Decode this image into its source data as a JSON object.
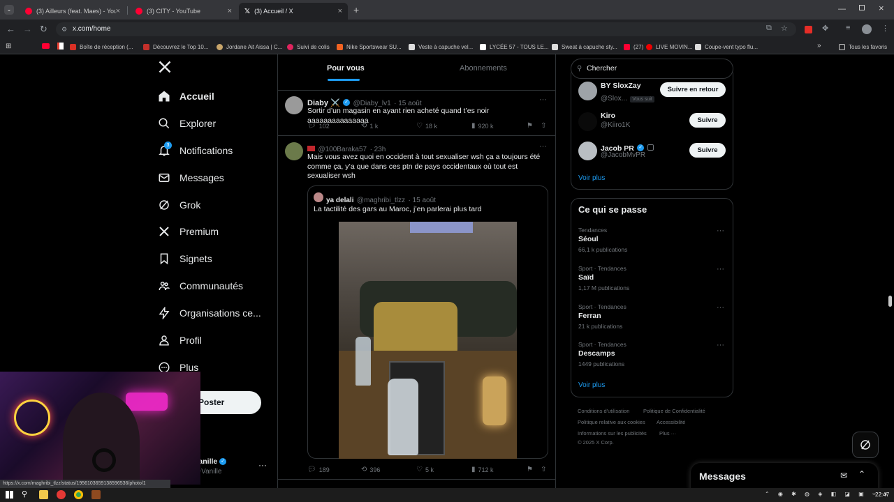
{
  "browser": {
    "tabs": [
      {
        "title": "(3) Ailleurs (feat. Maes) - YouTube",
        "favicon": "youtube-icon"
      },
      {
        "title": "(3) CITY - YouTube",
        "favicon": "youtube-icon"
      },
      {
        "title": "(3) Accueil / X",
        "favicon": "x-icon",
        "active": true
      }
    ],
    "url": "x.com/home",
    "bookmarks": [
      "Boîte de réception (...",
      "Découvrez le Top 10...",
      "Jordane Ait Aissa | C...",
      "Suivi de colis",
      "Nike Sportswear SU...",
      "Veste à capuche vel...",
      "LYCÉE 57 - TOUS LE...",
      "Sweat à capuche sty...",
      "(27)",
      "LIVE MOVIN...",
      "Coupe-vent typo flu..."
    ],
    "all_bookmarks": "Tous les favoris",
    "status_url": "https://x.com/maghribi_tlzz/status/1956103659138596536/photo/1"
  },
  "nav": {
    "items": [
      {
        "label": "Accueil",
        "icon": "home-icon"
      },
      {
        "label": "Explorer",
        "icon": "search-icon"
      },
      {
        "label": "Notifications",
        "icon": "bell-icon",
        "badge": "3"
      },
      {
        "label": "Messages",
        "icon": "envelope-icon"
      },
      {
        "label": "Grok",
        "icon": "grok-icon"
      },
      {
        "label": "Premium",
        "icon": "x-icon"
      },
      {
        "label": "Signets",
        "icon": "bookmark-icon"
      },
      {
        "label": "Communautés",
        "icon": "people-icon"
      },
      {
        "label": "Organisations ce...",
        "icon": "lightning-icon"
      },
      {
        "label": "Profil",
        "icon": "person-icon"
      },
      {
        "label": "Plus",
        "icon": "more-icon"
      }
    ],
    "post_label": "Poster",
    "account_name": "Vanille",
    "account_handle": "@Vanille"
  },
  "feed": {
    "tabs": [
      "Pour vous",
      "Abonnements"
    ],
    "tweet1": {
      "name": "Diaby ⚔️",
      "handle": "@Diaby_lv1",
      "time": "· 15 août",
      "text": "Sortir d’un magasin en ayant rien acheté quand t’es noir aaaaaaaaaaaaaaa",
      "replies": "102",
      "retweets": "1 k",
      "likes": "18 k",
      "views": "920 k"
    },
    "tweet2": {
      "handle": "@100Baraka57",
      "time": "· 23h",
      "text": "Mais vous avez quoi en occident à tout sexualiser wsh ça a toujours été comme ça, y’a que dans ces ptn de pays occidentaux où tout est sexualiser wsh",
      "quote_name": "ya delali",
      "quote_handle": "@maghribi_tlzz",
      "quote_time": "· 15 août",
      "quote_text": "La tactilité des gars au Maroc, j’en parlerai plus tard",
      "replies": "189",
      "retweets": "396",
      "likes": "5 k",
      "views": "712 k"
    }
  },
  "sidebar": {
    "search_placeholder": "Chercher",
    "follows": [
      {
        "name": "BY SloxZay",
        "handle": "@Slox...",
        "badge": "Vous suit",
        "button": "Suivre en retour"
      },
      {
        "name": "Kiro",
        "handle": "@Kiiro1K",
        "button": "Suivre"
      },
      {
        "name": "Jacob PR",
        "handle": "@JacobMvPR",
        "button": "Suivre"
      }
    ],
    "see_more": "Voir plus",
    "trends_title": "Ce qui se passe",
    "trends": [
      {
        "category": "Tendances",
        "name": "Séoul",
        "count": "66,1 k publications"
      },
      {
        "category": "Sport · Tendances",
        "name": "Saïd",
        "count": "1,17 M publications"
      },
      {
        "category": "Sport · Tendances",
        "name": "Ferran",
        "count": "21 k publications"
      },
      {
        "category": "Sport · Tendances",
        "name": "Descamps",
        "count": "1449 publications"
      }
    ],
    "footer": [
      "Conditions d'utilisation",
      "Politique de Confidentialité",
      "Politique relative aux cookies",
      "Accessibilité",
      "Informations sur les publicités",
      "Plus ···",
      "© 2025 X Corp."
    ]
  },
  "messages_drawer": {
    "title": "Messages"
  },
  "taskbar": {
    "time": "22:47"
  },
  "colors": {
    "accent": "#1d9bf0",
    "background": "#000000",
    "border": "#2f3336",
    "muted": "#71767b"
  }
}
